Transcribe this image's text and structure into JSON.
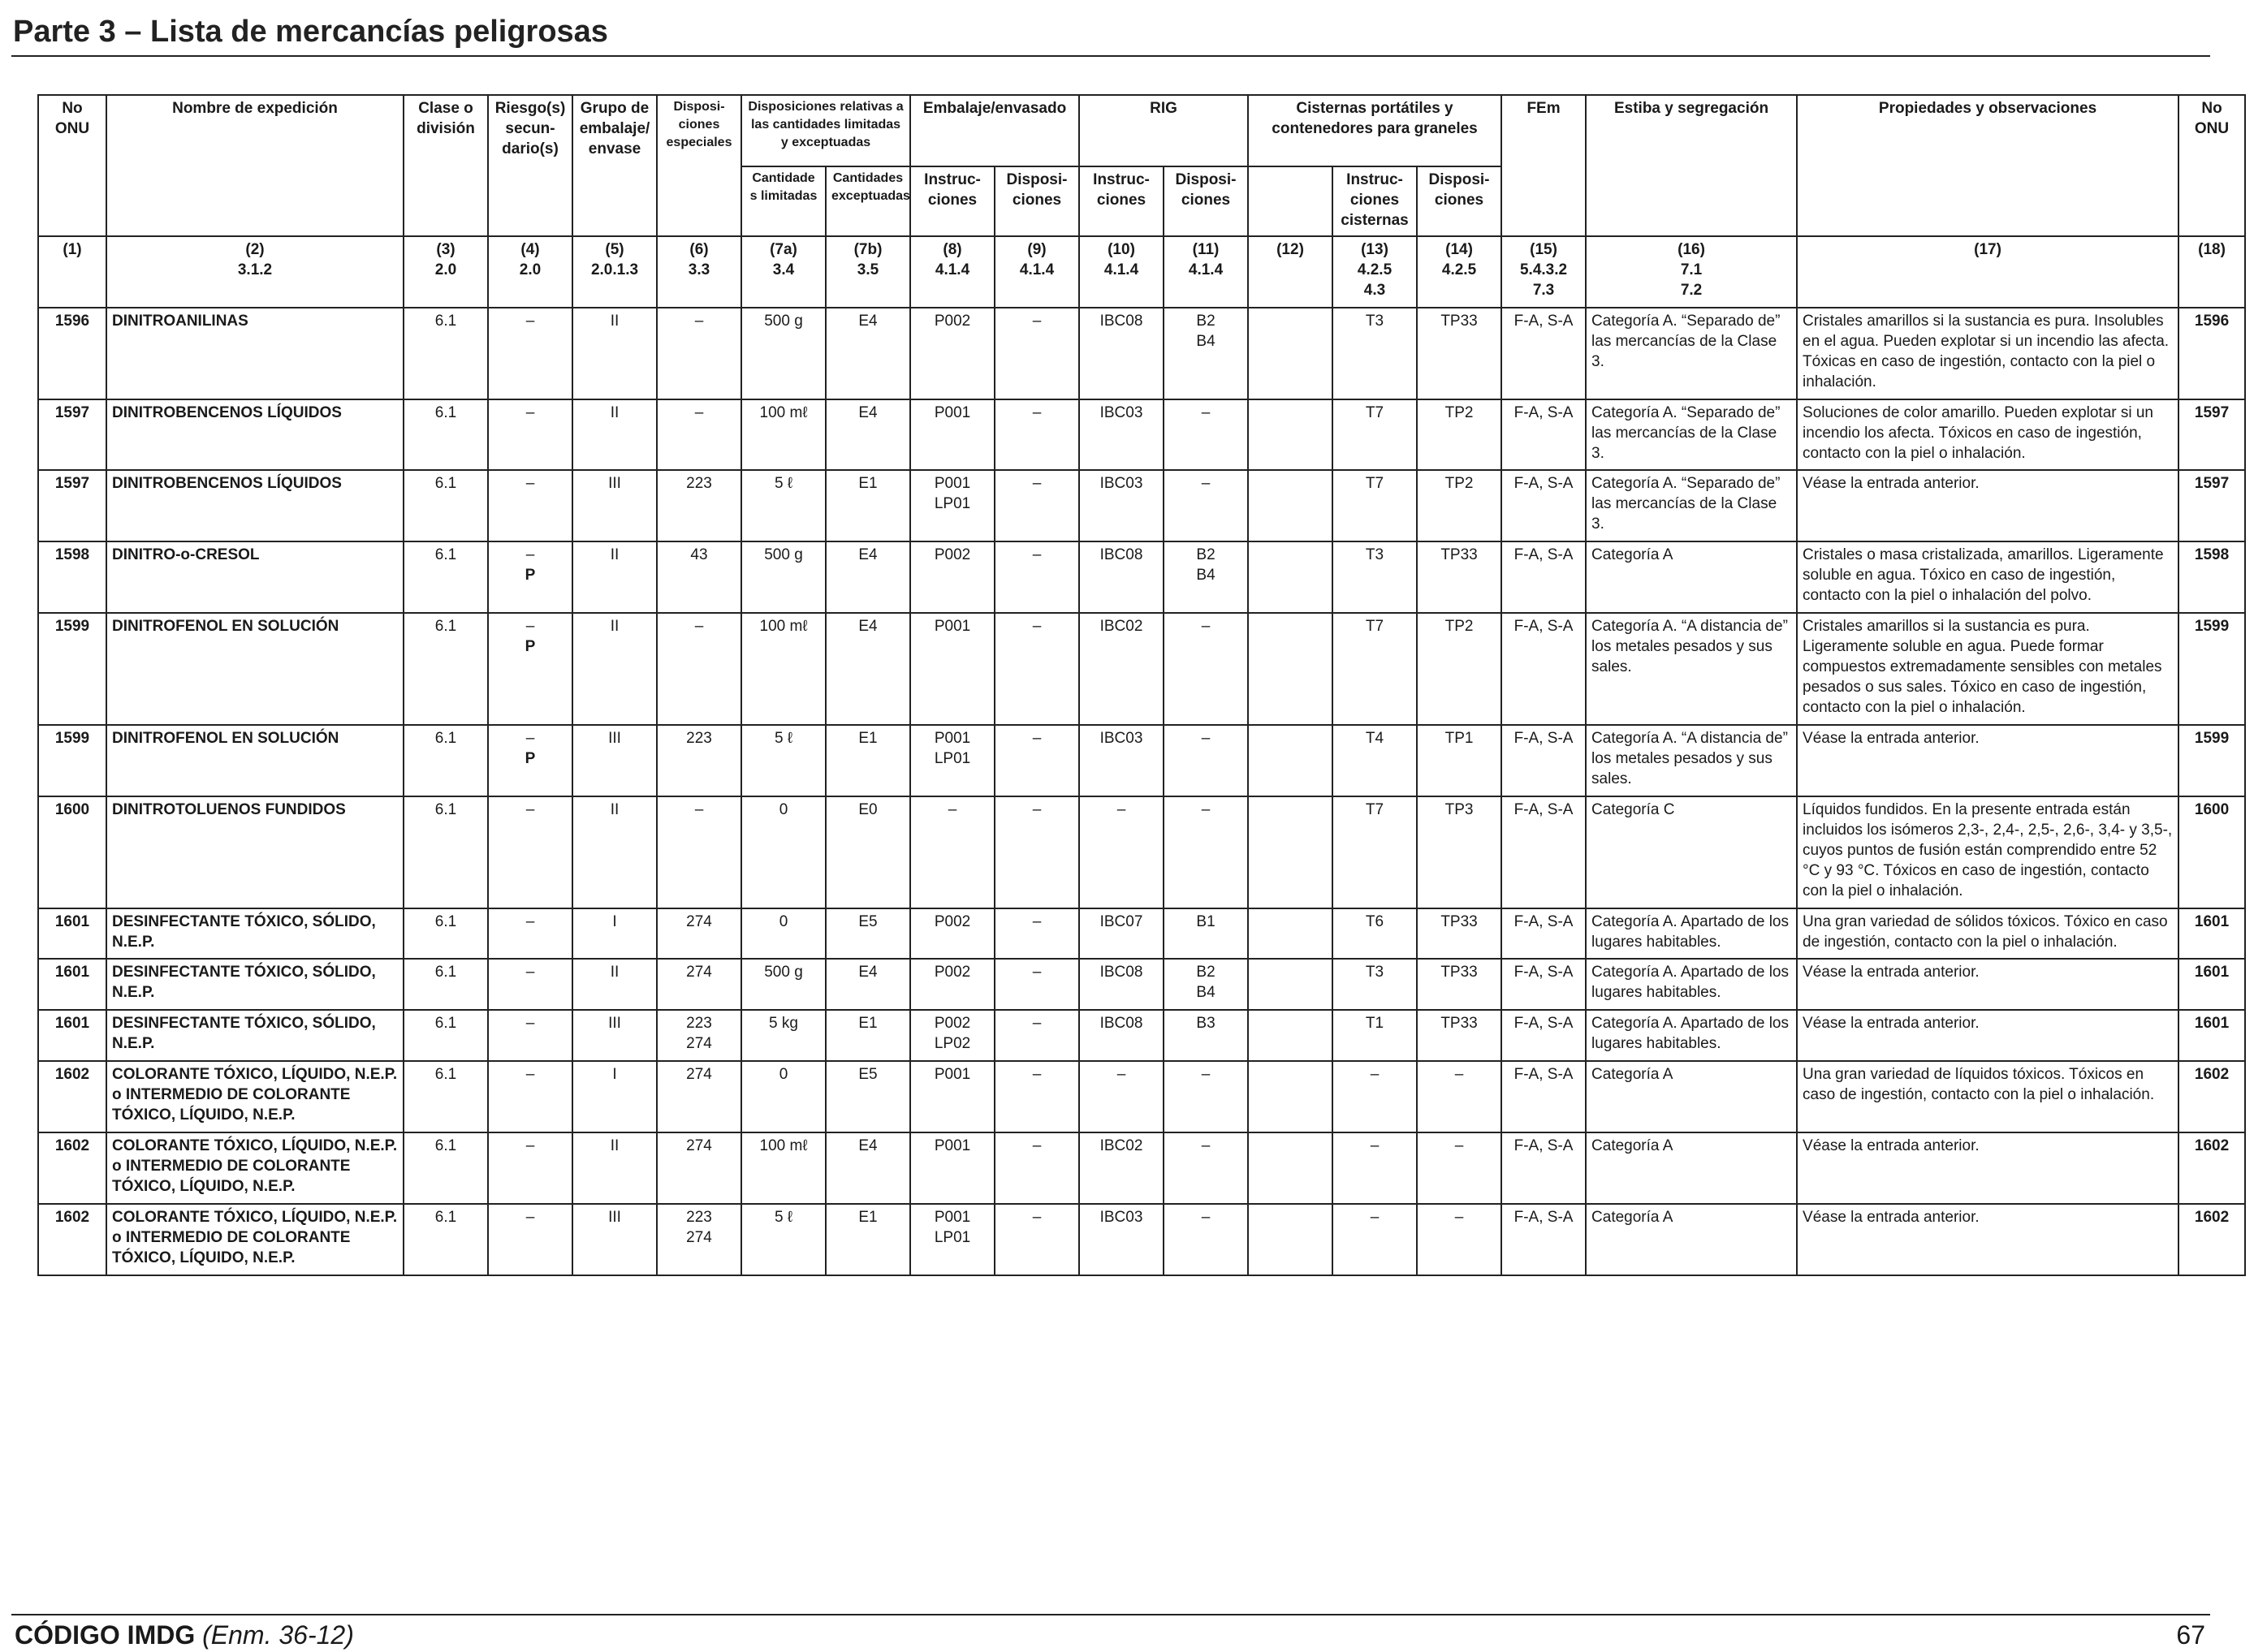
{
  "page": {
    "header_title": "Parte 3 – Lista de mercancías peligrosas",
    "footer_code": "CÓDIGO IMDG",
    "footer_amendment": "(Enm. 36-12)",
    "page_number": "67"
  },
  "headers": {
    "no_onu": "No ONU",
    "nombre": "Nombre de expedición",
    "clase": "Clase o división",
    "riesgo": "Riesgo(s) secun- dario(s)",
    "grupo": "Grupo de embalaje/ envase",
    "dispos_esp": "Disposi- ciones especiales",
    "dispos_cant": "Disposiciones relativas a las cantidades limitadas y exceptuadas",
    "embalaje": "Embalaje/envasado",
    "rig": "RIG",
    "cisternas": "Cisternas portátiles y contenedores para graneles",
    "fem": "FEm",
    "estiba": "Estiba y segregación",
    "propiedades": "Propiedades y observaciones",
    "no_onu_end": "No ONU",
    "cant_lim": "Cantidade s limitadas",
    "cant_exc": "Cantidades exceptuadas",
    "instruc_emb": "Instruc- ciones",
    "dispos_emb": "Disposi- ciones",
    "instruc_rig": "Instruc- ciones",
    "dispos_rig": "Disposi- ciones",
    "instruc_cist": "Instruc- ciones cisternas",
    "dispos_cist": "Disposi- ciones",
    "num": {
      "c1": "(1)",
      "c2a": "(2)",
      "c2b": "3.1.2",
      "c3a": "(3)",
      "c3b": "2.0",
      "c4a": "(4)",
      "c4b": "2.0",
      "c5a": "(5)",
      "c5b": "2.0.1.3",
      "c6a": "(6)",
      "c6b": "3.3",
      "c7aa": "(7a)",
      "c7ab": "3.4",
      "c7ba": "(7b)",
      "c7bb": "3.5",
      "c8a": "(8)",
      "c8b": "4.1.4",
      "c9a": "(9)",
      "c9b": "4.1.4",
      "c10a": "(10)",
      "c10b": "4.1.4",
      "c11a": "(11)",
      "c11b": "4.1.4",
      "c12": "(12)",
      "c13a": "(13)",
      "c13b": "4.2.5",
      "c13c": "4.3",
      "c14a": "(14)",
      "c14b": "4.2.5",
      "c15a": "(15)",
      "c15b": "5.4.3.2",
      "c15c": "7.3",
      "c16a": "(16)",
      "c16b": "7.1",
      "c16c": "7.2",
      "c17": "(17)",
      "c18": "(18)"
    }
  },
  "rows": [
    {
      "onu": "1596",
      "name": "DINITROANILINAS",
      "cls": "6.1",
      "sub1": "–",
      "sub2": "",
      "pg": "II",
      "sp1": "–",
      "sp2": "",
      "lq": "500 g",
      "eq": "E4",
      "pi1": "P002",
      "pi2": "",
      "pp": "–",
      "ibc": "IBC08",
      "ibcp1": "B2",
      "ibcp2": "B4",
      "c12": "",
      "tank": "T3",
      "tp": "TP33",
      "ems": "F-A, S-A",
      "stow": "Categoría A. “Separado de” las mercancías de la Clase 3.",
      "props": "Cristales amarillos si la sustancia es pura. Insolubles en el agua. Pueden explotar si un incendio las afecta. Tóxicas en caso de ingestión, contacto con la piel o inhalación.",
      "onu2": "1596"
    },
    {
      "onu": "1597",
      "name": "DINITROBENCENOS LÍQUIDOS",
      "cls": "6.1",
      "sub1": "–",
      "sub2": "",
      "pg": "II",
      "sp1": "–",
      "sp2": "",
      "lq": "100 mℓ",
      "eq": "E4",
      "pi1": "P001",
      "pi2": "",
      "pp": "–",
      "ibc": "IBC03",
      "ibcp1": "–",
      "ibcp2": "",
      "c12": "",
      "tank": "T7",
      "tp": "TP2",
      "ems": "F-A, S-A",
      "stow": "Categoría A. “Separado de” las mercancías de la Clase 3.",
      "props": "Soluciones de color amarillo. Pueden explotar si un incendio los afecta. Tóxicos en caso de ingestión, contacto con la piel o inhalación.",
      "onu2": "1597"
    },
    {
      "onu": "1597",
      "name": "DINITROBENCENOS LÍQUIDOS",
      "cls": "6.1",
      "sub1": "–",
      "sub2": "",
      "pg": "III",
      "sp1": "223",
      "sp2": "",
      "lq": "5 ℓ",
      "eq": "E1",
      "pi1": "P001",
      "pi2": "LP01",
      "pp": "–",
      "ibc": "IBC03",
      "ibcp1": "–",
      "ibcp2": "",
      "c12": "",
      "tank": "T7",
      "tp": "TP2",
      "ems": "F-A, S-A",
      "stow": "Categoría A. “Separado de” las mercancías de la Clase 3.",
      "props": "Véase la entrada anterior.",
      "onu2": "1597"
    },
    {
      "onu": "1598",
      "name": "DINITRO-o-CRESOL",
      "cls": "6.1",
      "sub1": "–",
      "sub2": "P",
      "pg": "II",
      "sp1": "43",
      "sp2": "",
      "lq": "500 g",
      "eq": "E4",
      "pi1": "P002",
      "pi2": "",
      "pp": "–",
      "ibc": "IBC08",
      "ibcp1": "B2",
      "ibcp2": "B4",
      "c12": "",
      "tank": "T3",
      "tp": "TP33",
      "ems": "F-A, S-A",
      "stow": "Categoría A",
      "props": "Cristales o masa cristalizada, amarillos. Ligeramente soluble en agua. Tóxico en caso de ingestión, contacto con la piel o inhalación del polvo.",
      "onu2": "1598"
    },
    {
      "onu": "1599",
      "name": "DINITROFENOL EN SOLUCIÓN",
      "cls": "6.1",
      "sub1": "–",
      "sub2": "P",
      "pg": "II",
      "sp1": "–",
      "sp2": "",
      "lq": "100 mℓ",
      "eq": "E4",
      "pi1": "P001",
      "pi2": "",
      "pp": "–",
      "ibc": "IBC02",
      "ibcp1": "–",
      "ibcp2": "",
      "c12": "",
      "tank": "T7",
      "tp": "TP2",
      "ems": "F-A, S-A",
      "stow": "Categoría A. “A distancia de” los metales pesados y sus sales.",
      "props": "Cristales amarillos si la sustancia es pura. Ligeramente soluble en agua. Puede formar compuestos extremadamente sensibles con metales pesados o sus sales. Tóxico en caso de ingestión, contacto con la piel o inhalación.",
      "onu2": "1599"
    },
    {
      "onu": "1599",
      "name": "DINITROFENOL EN SOLUCIÓN",
      "cls": "6.1",
      "sub1": "–",
      "sub2": "P",
      "pg": "III",
      "sp1": "223",
      "sp2": "",
      "lq": "5 ℓ",
      "eq": "E1",
      "pi1": "P001",
      "pi2": "LP01",
      "pp": "–",
      "ibc": "IBC03",
      "ibcp1": "–",
      "ibcp2": "",
      "c12": "",
      "tank": "T4",
      "tp": "TP1",
      "ems": "F-A, S-A",
      "stow": "Categoría A. “A distancia de” los metales pesados y sus sales.",
      "props": "Véase la entrada anterior.",
      "onu2": "1599"
    },
    {
      "onu": "1600",
      "name": "DINITROTOLUENOS FUNDIDOS",
      "cls": "6.1",
      "sub1": "–",
      "sub2": "",
      "pg": "II",
      "sp1": "–",
      "sp2": "",
      "lq": "0",
      "eq": "E0",
      "pi1": "–",
      "pi2": "",
      "pp": "–",
      "ibc": "–",
      "ibcp1": "–",
      "ibcp2": "",
      "c12": "",
      "tank": "T7",
      "tp": "TP3",
      "ems": "F-A, S-A",
      "stow": "Categoría C",
      "props": "Líquidos fundidos. En la presente entrada están incluidos los isómeros 2,3-, 2,4-, 2,5-, 2,6-, 3,4- y 3,5-, cuyos puntos de fusión están comprendido entre 52 °C y 93 °C. Tóxicos en caso de ingestión, contacto con la piel o inhalación.",
      "onu2": "1600"
    },
    {
      "onu": "1601",
      "name": "DESINFECTANTE TÓXICO, SÓLIDO, N.E.P.",
      "cls": "6.1",
      "sub1": "–",
      "sub2": "",
      "pg": "I",
      "sp1": "274",
      "sp2": "",
      "lq": "0",
      "eq": "E5",
      "pi1": "P002",
      "pi2": "",
      "pp": "–",
      "ibc": "IBC07",
      "ibcp1": "B1",
      "ibcp2": "",
      "c12": "",
      "tank": "T6",
      "tp": "TP33",
      "ems": "F-A, S-A",
      "stow": "Categoría A. Apartado de los lugares habitables.",
      "props": "Una gran variedad de sólidos tóxicos. Tóxico en caso de ingestión, contacto con la piel o inhalación.",
      "onu2": "1601"
    },
    {
      "onu": "1601",
      "name": "DESINFECTANTE TÓXICO, SÓLIDO, N.E.P.",
      "cls": "6.1",
      "sub1": "–",
      "sub2": "",
      "pg": "II",
      "sp1": "274",
      "sp2": "",
      "lq": "500 g",
      "eq": "E4",
      "pi1": "P002",
      "pi2": "",
      "pp": "–",
      "ibc": "IBC08",
      "ibcp1": "B2",
      "ibcp2": "B4",
      "c12": "",
      "tank": "T3",
      "tp": "TP33",
      "ems": "F-A, S-A",
      "stow": "Categoría A. Apartado de los lugares habitables.",
      "props": "Véase la entrada anterior.",
      "onu2": "1601"
    },
    {
      "onu": "1601",
      "name": "DESINFECTANTE TÓXICO, SÓLIDO, N.E.P.",
      "cls": "6.1",
      "sub1": "–",
      "sub2": "",
      "pg": "III",
      "sp1": "223",
      "sp2": "274",
      "lq": "5 kg",
      "eq": "E1",
      "pi1": "P002",
      "pi2": "LP02",
      "pp": "–",
      "ibc": "IBC08",
      "ibcp1": "B3",
      "ibcp2": "",
      "c12": "",
      "tank": "T1",
      "tp": "TP33",
      "ems": "F-A, S-A",
      "stow": "Categoría A. Apartado de los lugares habitables.",
      "props": "Véase la entrada anterior.",
      "onu2": "1601"
    },
    {
      "onu": "1602",
      "name": "COLORANTE TÓXICO, LÍQUIDO, N.E.P. o INTERMEDIO DE COLORANTE TÓXICO, LÍQUIDO, N.E.P.",
      "cls": "6.1",
      "sub1": "–",
      "sub2": "",
      "pg": "I",
      "sp1": "274",
      "sp2": "",
      "lq": "0",
      "eq": "E5",
      "pi1": "P001",
      "pi2": "",
      "pp": "–",
      "ibc": "–",
      "ibcp1": "–",
      "ibcp2": "",
      "c12": "",
      "tank": "–",
      "tp": "–",
      "ems": "F-A, S-A",
      "stow": "Categoría A",
      "props": "Una gran variedad de líquidos tóxicos. Tóxicos en caso de ingestión, contacto con la piel o inhalación.",
      "onu2": "1602"
    },
    {
      "onu": "1602",
      "name": "COLORANTE TÓXICO, LÍQUIDO, N.E.P. o INTERMEDIO DE COLORANTE TÓXICO, LÍQUIDO, N.E.P.",
      "cls": "6.1",
      "sub1": "–",
      "sub2": "",
      "pg": "II",
      "sp1": "274",
      "sp2": "",
      "lq": "100 mℓ",
      "eq": "E4",
      "pi1": "P001",
      "pi2": "",
      "pp": "–",
      "ibc": "IBC02",
      "ibcp1": "–",
      "ibcp2": "",
      "c12": "",
      "tank": "–",
      "tp": "–",
      "ems": "F-A, S-A",
      "stow": "Categoría A",
      "props": "Véase la entrada anterior.",
      "onu2": "1602"
    },
    {
      "onu": "1602",
      "name": "COLORANTE TÓXICO, LÍQUIDO, N.E.P. o INTERMEDIO DE COLORANTE TÓXICO, LÍQUIDO, N.E.P.",
      "cls": "6.1",
      "sub1": "–",
      "sub2": "",
      "pg": "III",
      "sp1": "223",
      "sp2": "274",
      "lq": "5 ℓ",
      "eq": "E1",
      "pi1": "P001",
      "pi2": "LP01",
      "pp": "–",
      "ibc": "IBC03",
      "ibcp1": "–",
      "ibcp2": "",
      "c12": "",
      "tank": "–",
      "tp": "–",
      "ems": "F-A, S-A",
      "stow": "Categoría A",
      "props": "Véase la entrada anterior.",
      "onu2": "1602"
    }
  ]
}
